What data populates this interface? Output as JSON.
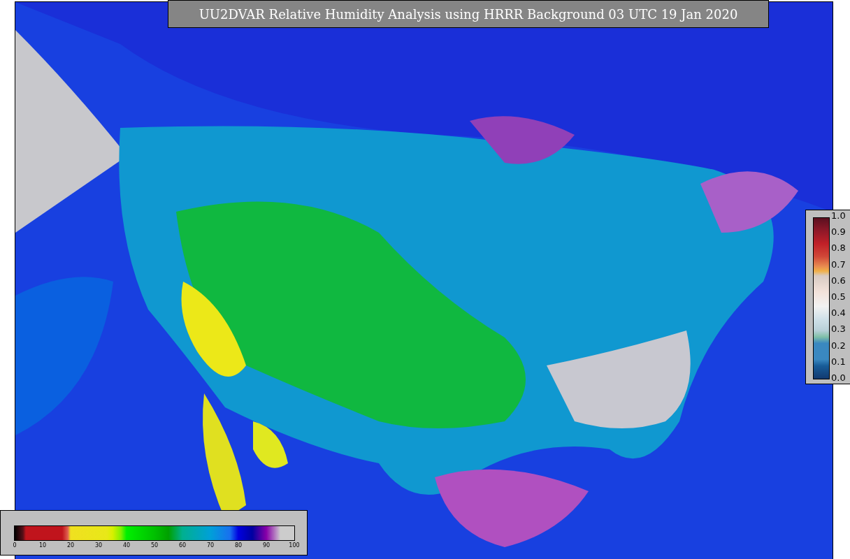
{
  "title": "UU2DVAR Relative Humidity Analysis using HRRR Background 03 UTC 19 Jan 2020",
  "humidity_colorbar": {
    "ticks": [
      "0",
      "10",
      "20",
      "30",
      "40",
      "50",
      "60",
      "70",
      "80",
      "90",
      "100"
    ]
  },
  "ratio_colorbar": {
    "ticks": [
      "1.0",
      "0.9",
      "0.8",
      "0.7",
      "0.6",
      "0.5",
      "0.4",
      "0.3",
      "0.2",
      "0.1",
      "0.0"
    ]
  }
}
